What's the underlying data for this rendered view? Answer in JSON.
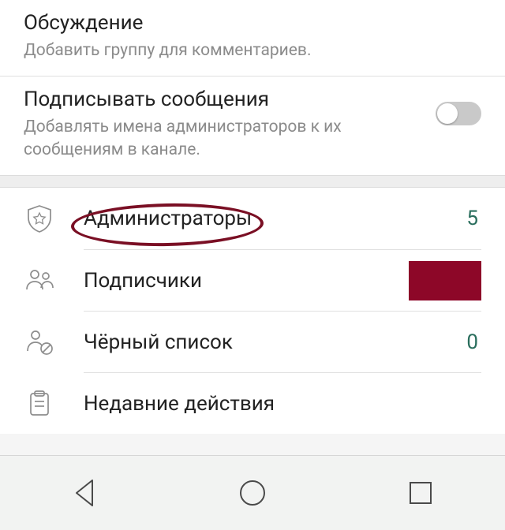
{
  "settings": {
    "discussion": {
      "title": "Обсуждение",
      "subtitle": "Добавить группу для комментариев."
    },
    "sign": {
      "title": "Подписывать сообщения",
      "subtitle": "Добавлять имена администраторов к их сообщениям в канале.",
      "enabled": false
    }
  },
  "list": {
    "admins": {
      "label": "Администраторы",
      "count": "5"
    },
    "subscribers": {
      "label": "Подписчики"
    },
    "blacklist": {
      "label": "Чёрный список",
      "count": "0"
    },
    "recent": {
      "label": "Недавние действия"
    }
  },
  "colors": {
    "accent_count": "#2a6e5d",
    "annotation": "#7a0f24",
    "redact": "#8d0728"
  }
}
